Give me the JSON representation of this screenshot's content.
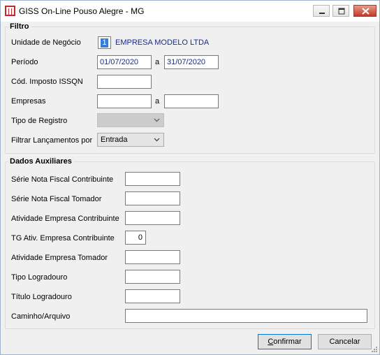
{
  "window": {
    "title": "GISS On-Line Pouso Alegre - MG",
    "icon": "giss-logo-icon",
    "controls": [
      "minimize-icon",
      "maximize-icon",
      "close-icon"
    ]
  },
  "filtro": {
    "legend": "Filtro",
    "unidade_label": "Unidade de Negócio",
    "unidade_code": "1",
    "unidade_name": "EMPRESA MODELO LTDA",
    "periodo_label": "Período",
    "periodo_from": "01/07/2020",
    "periodo_sep": "a",
    "periodo_to": "31/07/2020",
    "cod_imposto_label": "Cód. Imposto ISSQN",
    "cod_imposto_value": "",
    "empresas_label": "Empresas",
    "empresas_from": "",
    "empresas_sep": "a",
    "empresas_to": "",
    "tipo_registro_label": "Tipo de Registro",
    "tipo_registro_value": "",
    "filtrar_label": "Filtrar Lançamentos por",
    "filtrar_value": "Entrada"
  },
  "auxiliares": {
    "legend": "Dados Auxiliares",
    "serie_contribuinte_label": "Série Nota Fiscal Contribuinte",
    "serie_tomador_label": "Série Nota Fiscal Tomador",
    "atividade_contribuinte_label": "Atividade Empresa Contribuinte",
    "tg_ativ_label": "TG Ativ. Empresa Contribuinte",
    "tg_ativ_value": "0",
    "atividade_tomador_label": "Atividade Empresa Tomador",
    "tipo_logradouro_label": "Tipo Logradouro",
    "titulo_logradouro_label": "Título Logradouro",
    "caminho_label": "Caminho/Arquivo"
  },
  "buttons": {
    "confirmar_underline": "C",
    "confirmar_rest": "onfirmar",
    "cancelar": "Cancelar"
  },
  "colors": {
    "accent": "#0078d7",
    "value_text": "#1a2a8a",
    "close_button": "#c0392b"
  }
}
